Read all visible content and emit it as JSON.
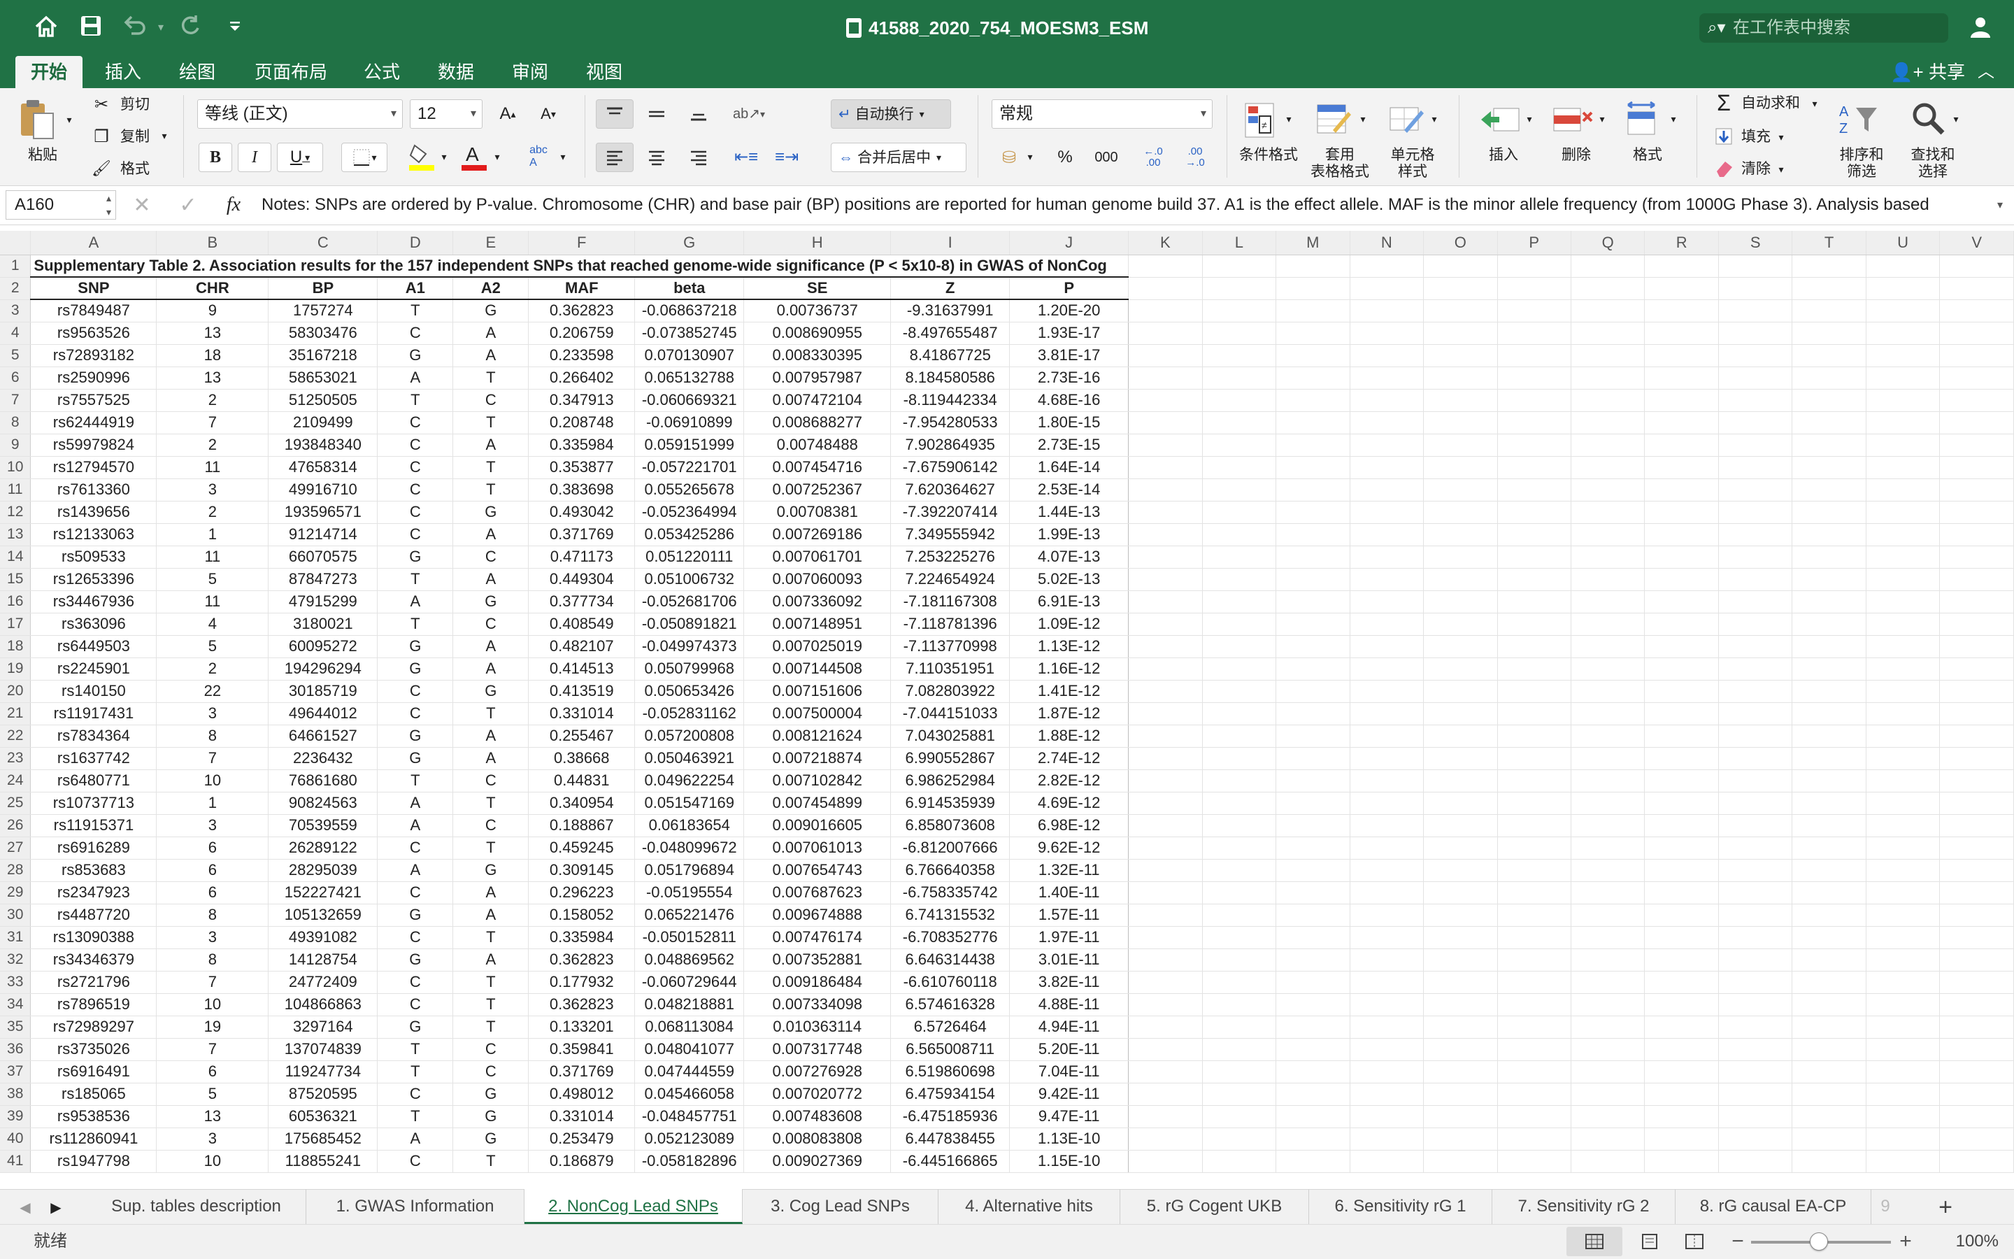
{
  "titlebar": {
    "title": "41588_2020_754_MOESM3_ESM",
    "search_placeholder": "在工作表中搜索"
  },
  "ribbon_tabs": [
    "开始",
    "插入",
    "绘图",
    "页面布局",
    "公式",
    "数据",
    "审阅",
    "视图"
  ],
  "share_label": "共享",
  "clipboard": {
    "paste": "粘贴",
    "cut": "剪切",
    "copy": "复制",
    "format": "格式"
  },
  "font": {
    "name": "等线 (正文)",
    "size": "12"
  },
  "alignment": {
    "wrap": "自动换行",
    "merge": "合并后居中"
  },
  "number": {
    "format": "常规",
    "percent": "%",
    "thousands": "000"
  },
  "styles": {
    "conditional": "条件格式",
    "table_format": "套用\n表格格式",
    "cell_style": "单元格\n样式"
  },
  "cells": {
    "insert": "插入",
    "delete": "删除",
    "format": "格式"
  },
  "editing": {
    "autosum": "自动求和",
    "fill": "填充",
    "clear": "清除",
    "sort": "排序和\n筛选",
    "find": "查找和\n选择"
  },
  "formula_bar": {
    "cell_ref": "A160",
    "fx": "fx",
    "content": "Notes: SNPs are ordered by P-value. Chromosome (CHR) and base pair (BP) positions are reported for human genome build 37. A1 is the effect allele. MAF is the minor allele frequency (from 1000G Phase 3). Analysis based"
  },
  "grid": {
    "columns": [
      "A",
      "B",
      "C",
      "D",
      "E",
      "F",
      "G",
      "H",
      "I",
      "J",
      "K",
      "L",
      "M",
      "N",
      "O",
      "P",
      "Q",
      "R",
      "S",
      "T",
      "U",
      "V"
    ],
    "title": "Supplementary Table 2. Association results for the 157 independent SNPs that reached genome-wide significance (P < 5x10-8) in GWAS of NonCog",
    "headers": [
      "SNP",
      "CHR",
      "BP",
      "A1",
      "A2",
      "MAF",
      "beta",
      "SE",
      "Z",
      "P"
    ],
    "rows": [
      [
        "rs7849487",
        "9",
        "1757274",
        "T",
        "G",
        "0.362823",
        "-0.068637218",
        "0.00736737",
        "-9.31637991",
        "1.20E-20"
      ],
      [
        "rs9563526",
        "13",
        "58303476",
        "C",
        "A",
        "0.206759",
        "-0.073852745",
        "0.008690955",
        "-8.497655487",
        "1.93E-17"
      ],
      [
        "rs72893182",
        "18",
        "35167218",
        "G",
        "A",
        "0.233598",
        "0.070130907",
        "0.008330395",
        "8.41867725",
        "3.81E-17"
      ],
      [
        "rs2590996",
        "13",
        "58653021",
        "A",
        "T",
        "0.266402",
        "0.065132788",
        "0.007957987",
        "8.184580586",
        "2.73E-16"
      ],
      [
        "rs7557525",
        "2",
        "51250505",
        "T",
        "C",
        "0.347913",
        "-0.060669321",
        "0.007472104",
        "-8.119442334",
        "4.68E-16"
      ],
      [
        "rs62444919",
        "7",
        "2109499",
        "C",
        "T",
        "0.208748",
        "-0.06910899",
        "0.008688277",
        "-7.954280533",
        "1.80E-15"
      ],
      [
        "rs59979824",
        "2",
        "193848340",
        "C",
        "A",
        "0.335984",
        "0.059151999",
        "0.00748488",
        "7.902864935",
        "2.73E-15"
      ],
      [
        "rs12794570",
        "11",
        "47658314",
        "C",
        "T",
        "0.353877",
        "-0.057221701",
        "0.007454716",
        "-7.675906142",
        "1.64E-14"
      ],
      [
        "rs7613360",
        "3",
        "49916710",
        "C",
        "T",
        "0.383698",
        "0.055265678",
        "0.007252367",
        "7.620364627",
        "2.53E-14"
      ],
      [
        "rs1439656",
        "2",
        "193596571",
        "C",
        "G",
        "0.493042",
        "-0.052364994",
        "0.00708381",
        "-7.392207414",
        "1.44E-13"
      ],
      [
        "rs12133063",
        "1",
        "91214714",
        "C",
        "A",
        "0.371769",
        "0.053425286",
        "0.007269186",
        "7.349555942",
        "1.99E-13"
      ],
      [
        "rs509533",
        "11",
        "66070575",
        "G",
        "C",
        "0.471173",
        "0.051220111",
        "0.007061701",
        "7.253225276",
        "4.07E-13"
      ],
      [
        "rs12653396",
        "5",
        "87847273",
        "T",
        "A",
        "0.449304",
        "0.051006732",
        "0.007060093",
        "7.224654924",
        "5.02E-13"
      ],
      [
        "rs34467936",
        "11",
        "47915299",
        "A",
        "G",
        "0.377734",
        "-0.052681706",
        "0.007336092",
        "-7.181167308",
        "6.91E-13"
      ],
      [
        "rs363096",
        "4",
        "3180021",
        "T",
        "C",
        "0.408549",
        "-0.050891821",
        "0.007148951",
        "-7.118781396",
        "1.09E-12"
      ],
      [
        "rs6449503",
        "5",
        "60095272",
        "G",
        "A",
        "0.482107",
        "-0.049974373",
        "0.007025019",
        "-7.113770998",
        "1.13E-12"
      ],
      [
        "rs2245901",
        "2",
        "194296294",
        "G",
        "A",
        "0.414513",
        "0.050799968",
        "0.007144508",
        "7.110351951",
        "1.16E-12"
      ],
      [
        "rs140150",
        "22",
        "30185719",
        "C",
        "G",
        "0.413519",
        "0.050653426",
        "0.007151606",
        "7.082803922",
        "1.41E-12"
      ],
      [
        "rs11917431",
        "3",
        "49644012",
        "C",
        "T",
        "0.331014",
        "-0.052831162",
        "0.007500004",
        "-7.044151033",
        "1.87E-12"
      ],
      [
        "rs7834364",
        "8",
        "64661527",
        "G",
        "A",
        "0.255467",
        "0.057200808",
        "0.008121624",
        "7.043025881",
        "1.88E-12"
      ],
      [
        "rs1637742",
        "7",
        "2236432",
        "G",
        "A",
        "0.38668",
        "0.050463921",
        "0.007218874",
        "6.990552867",
        "2.74E-12"
      ],
      [
        "rs6480771",
        "10",
        "76861680",
        "T",
        "C",
        "0.44831",
        "0.049622254",
        "0.007102842",
        "6.986252984",
        "2.82E-12"
      ],
      [
        "rs10737713",
        "1",
        "90824563",
        "A",
        "T",
        "0.340954",
        "0.051547169",
        "0.007454899",
        "6.914535939",
        "4.69E-12"
      ],
      [
        "rs11915371",
        "3",
        "70539559",
        "A",
        "C",
        "0.188867",
        "0.06183654",
        "0.009016605",
        "6.858073608",
        "6.98E-12"
      ],
      [
        "rs6916289",
        "6",
        "26289122",
        "C",
        "T",
        "0.459245",
        "-0.048099672",
        "0.007061013",
        "-6.812007666",
        "9.62E-12"
      ],
      [
        "rs853683",
        "6",
        "28295039",
        "A",
        "G",
        "0.309145",
        "0.051796894",
        "0.007654743",
        "6.766640358",
        "1.32E-11"
      ],
      [
        "rs2347923",
        "6",
        "152227421",
        "C",
        "A",
        "0.296223",
        "-0.05195554",
        "0.007687623",
        "-6.758335742",
        "1.40E-11"
      ],
      [
        "rs4487720",
        "8",
        "105132659",
        "G",
        "A",
        "0.158052",
        "0.065221476",
        "0.009674888",
        "6.741315532",
        "1.57E-11"
      ],
      [
        "rs13090388",
        "3",
        "49391082",
        "C",
        "T",
        "0.335984",
        "-0.050152811",
        "0.007476174",
        "-6.708352776",
        "1.97E-11"
      ],
      [
        "rs34346379",
        "8",
        "14128754",
        "G",
        "A",
        "0.362823",
        "0.048869562",
        "0.007352881",
        "6.646314438",
        "3.01E-11"
      ],
      [
        "rs2721796",
        "7",
        "24772409",
        "C",
        "T",
        "0.177932",
        "-0.060729644",
        "0.009186484",
        "-6.610760118",
        "3.82E-11"
      ],
      [
        "rs7896519",
        "10",
        "104866863",
        "C",
        "T",
        "0.362823",
        "0.048218881",
        "0.007334098",
        "6.574616328",
        "4.88E-11"
      ],
      [
        "rs72989297",
        "19",
        "3297164",
        "G",
        "T",
        "0.133201",
        "0.068113084",
        "0.010363114",
        "6.5726464",
        "4.94E-11"
      ],
      [
        "rs3735026",
        "7",
        "137074839",
        "T",
        "C",
        "0.359841",
        "0.048041077",
        "0.007317748",
        "6.565008711",
        "5.20E-11"
      ],
      [
        "rs6916491",
        "6",
        "119247734",
        "T",
        "C",
        "0.371769",
        "0.047444559",
        "0.007276928",
        "6.519860698",
        "7.04E-11"
      ],
      [
        "rs185065",
        "5",
        "87520595",
        "C",
        "G",
        "0.498012",
        "0.045466058",
        "0.007020772",
        "6.475934154",
        "9.42E-11"
      ],
      [
        "rs9538536",
        "13",
        "60536321",
        "T",
        "G",
        "0.331014",
        "-0.048457751",
        "0.007483608",
        "-6.475185936",
        "9.47E-11"
      ],
      [
        "rs112860941",
        "3",
        "175685452",
        "A",
        "G",
        "0.253479",
        "0.052123089",
        "0.008083808",
        "6.447838455",
        "1.13E-10"
      ],
      [
        "rs1947798",
        "10",
        "118855241",
        "C",
        "T",
        "0.186879",
        "-0.058182896",
        "0.009027369",
        "-6.445166865",
        "1.15E-10"
      ]
    ]
  },
  "sheet_tabs": [
    "Sup. tables description",
    "1. GWAS Information",
    "2. NonCog Lead SNPs",
    "3. Cog Lead SNPs",
    "4. Alternative hits",
    "5. rG Cogent UKB",
    "6. Sensitivity rG 1",
    "7. Sensitivity rG 2",
    "8. rG causal EA-CP",
    "9"
  ],
  "active_sheet": "2. NonCog Lead SNPs",
  "status": {
    "text": "就绪",
    "zoom": "100%"
  }
}
